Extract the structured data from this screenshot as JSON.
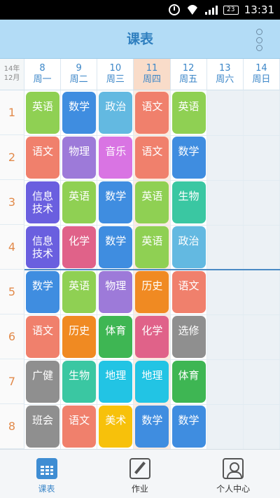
{
  "status_bar": {
    "time": "13:31",
    "battery": "23"
  },
  "header": {
    "title": "课表"
  },
  "schedule": {
    "corner_year": "14年",
    "corner_month": "12月",
    "days": [
      {
        "date": "8",
        "weekday": "周一"
      },
      {
        "date": "9",
        "weekday": "周二"
      },
      {
        "date": "10",
        "weekday": "周三"
      },
      {
        "date": "11",
        "weekday": "周四",
        "today": true
      },
      {
        "date": "12",
        "weekday": "周五"
      },
      {
        "date": "13",
        "weekday": "周六"
      },
      {
        "date": "14",
        "weekday": "周日"
      }
    ],
    "periods": [
      "1",
      "2",
      "3",
      "4",
      "5",
      "6",
      "7",
      "8"
    ],
    "lessons": [
      [
        "英语",
        "数学",
        "政治",
        "语文",
        "英语"
      ],
      [
        "语文",
        "物理",
        "音乐",
        "语文",
        "数学"
      ],
      [
        "信息技术",
        "英语",
        "数学",
        "英语",
        "生物"
      ],
      [
        "信息技术",
        "化学",
        "数学",
        "英语",
        "政治"
      ],
      [
        "数学",
        "英语",
        "物理",
        "历史",
        "语文"
      ],
      [
        "语文",
        "历史",
        "体育",
        "化学",
        "选修"
      ],
      [
        "广健",
        "生物",
        "地理",
        "地理",
        "体育"
      ],
      [
        "班会",
        "语文",
        "美术",
        "数学",
        "数学"
      ]
    ],
    "subject_colors": {
      "英语": "#8fd053",
      "数学": "#3f8de0",
      "政治": "#63b9e1",
      "语文": "#f0806c",
      "物理": "#9d7ad9",
      "音乐": "#d974e3",
      "信息技术": "#6a5fdf",
      "生物": "#3ac7a2",
      "化学": "#e06289",
      "历史": "#f08a22",
      "体育": "#3eb653",
      "选修": "#8f8f8f",
      "广健": "#8f8f8f",
      "地理": "#22c4e4",
      "班会": "#8f8f8f",
      "美术": "#f7c10b"
    }
  },
  "bottom_nav": {
    "items": [
      {
        "label": "课表",
        "icon": "schedule-icon",
        "active": true
      },
      {
        "label": "作业",
        "icon": "homework-icon"
      },
      {
        "label": "个人中心",
        "icon": "profile-icon"
      }
    ]
  }
}
